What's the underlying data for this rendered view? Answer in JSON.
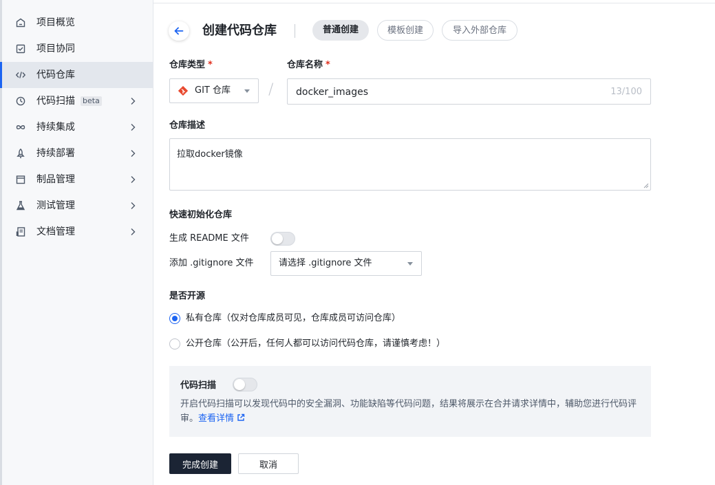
{
  "sidebar": {
    "items": [
      {
        "label": "项目概览",
        "icon": "home-icon",
        "active": false,
        "expandable": false
      },
      {
        "label": "项目协同",
        "icon": "task-icon",
        "active": false,
        "expandable": false
      },
      {
        "label": "代码仓库",
        "icon": "code-icon",
        "active": true,
        "expandable": false
      },
      {
        "label": "代码扫描",
        "icon": "scan-icon",
        "badge": "beta",
        "active": false,
        "expandable": true
      },
      {
        "label": "持续集成",
        "icon": "infinity-icon",
        "active": false,
        "expandable": true
      },
      {
        "label": "持续部署",
        "icon": "rocket-icon",
        "active": false,
        "expandable": true
      },
      {
        "label": "制品管理",
        "icon": "box-icon",
        "active": false,
        "expandable": true
      },
      {
        "label": "测试管理",
        "icon": "flask-icon",
        "active": false,
        "expandable": true
      },
      {
        "label": "文档管理",
        "icon": "document-icon",
        "active": false,
        "expandable": true
      }
    ]
  },
  "header": {
    "title": "创建代码仓库",
    "tabs": [
      "普通创建",
      "模板创建",
      "导入外部仓库"
    ],
    "active_tab": "普通创建"
  },
  "form": {
    "repo_type_label": "仓库类型",
    "repo_type_value": "GIT 仓库",
    "repo_name_label": "仓库名称",
    "required_mark": "*",
    "repo_name_value": "docker_images",
    "repo_name_count": "13/100",
    "repo_desc_label": "仓库描述",
    "repo_desc_value": "拉取docker镜像",
    "quick_init_label": "快速初始化仓库",
    "readme_label": "生成 README 文件",
    "readme_enabled": false,
    "gitignore_label": "添加 .gitignore 文件",
    "gitignore_placeholder": "请选择 .gitignore 文件",
    "open_source_label": "是否开源",
    "private_option": "私有仓库（仅对仓库成员可见，仓库成员可访问仓库）",
    "public_option": "公开仓库（公开后，任何人都可以访问代码仓库，请谨慎考虑！）",
    "selected_visibility": "private"
  },
  "code_scan": {
    "title": "代码扫描",
    "enabled": false,
    "description": "开启代码扫描可以发现代码中的安全漏洞、功能缺陷等代码问题，结果将展示在合并请求详情中，辅助您进行代码评审。",
    "link_text": "查看详情"
  },
  "actions": {
    "submit": "完成创建",
    "cancel": "取消"
  },
  "colors": {
    "accent": "#1c64f2",
    "primary_button": "#1b2434",
    "required": "#e0301e",
    "git_logo": "#e8492f"
  }
}
